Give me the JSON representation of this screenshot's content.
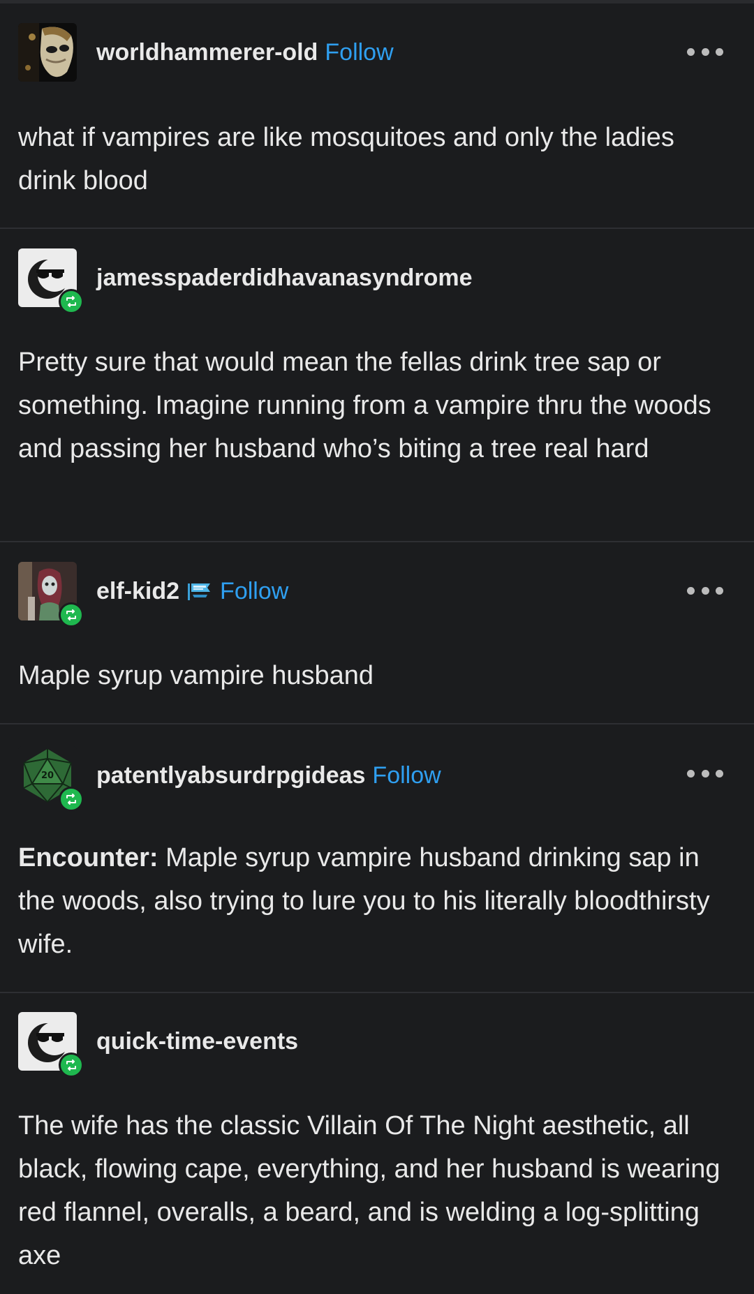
{
  "posts": [
    {
      "username": "worldhammerer-old",
      "follow_label": "Follow",
      "avatar_icon": "venetian-mask-avatar",
      "is_reblog": false,
      "body": "what if vampires are like mosquitoes and only the ladies drink blood"
    },
    {
      "username": "jamesspaderdidhavanasyndrome",
      "avatar_icon": "sunglasses-moon-avatar",
      "is_reblog": true,
      "body": "Pretty sure that would mean the fellas drink tree sap or something. Imagine running from a vampire thru the woods and passing her husband who’s biting a tree real hard"
    },
    {
      "username": "elf-kid2",
      "badge_icon": "flag-badge-icon",
      "follow_label": "Follow",
      "avatar_icon": "doll-portrait-avatar",
      "is_reblog": true,
      "body": "Maple syrup vampire husband"
    },
    {
      "username": "patentlyabsurdrpgideas",
      "follow_label": "Follow",
      "avatar_icon": "d20-dice-avatar",
      "is_reblog": true,
      "body_label": "Encounter:",
      "body": " Maple syrup vampire husband drinking sap in the woods, also trying to lure you to his literally bloodthirsty wife."
    },
    {
      "username": "quick-time-events",
      "avatar_icon": "sunglasses-moon-avatar",
      "is_reblog": true,
      "body": "The wife has the classic Villain Of The Night aesthetic, all black, flowing cape, everything, and her husband is wearing red flannel, overalls, a beard, and is welding a log-splitting axe"
    }
  ],
  "colors": {
    "background": "#1b1c1e",
    "text": "#e9e9e9",
    "follow": "#2f9ff0",
    "reblog_badge": "#1fb84f",
    "divider": "#2e2f33"
  }
}
